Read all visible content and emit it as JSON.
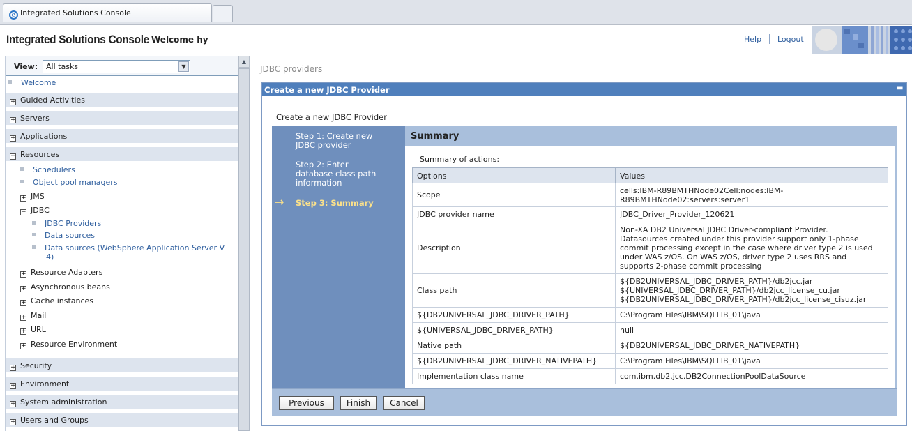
{
  "browser": {
    "tab_title": "Integrated Solutions Console"
  },
  "header": {
    "title": "Integrated Solutions Console",
    "welcome": "Welcome hy",
    "help": "Help",
    "logout": "Logout"
  },
  "nav": {
    "view_label": "View:",
    "view_value": "All tasks",
    "welcome": "Welcome",
    "guided": "Guided Activities",
    "servers": "Servers",
    "applications": "Applications",
    "resources": "Resources",
    "schedulers": "Schedulers",
    "object_pool": "Object pool managers",
    "jms": "JMS",
    "jdbc": "JDBC",
    "jdbc_providers": "JDBC Providers",
    "data_sources": "Data sources",
    "data_sources_was_1": "Data sources (WebSphere Application Server V",
    "data_sources_was_2": "4)",
    "resource_adapters": "Resource Adapters",
    "async_beans": "Asynchronous beans",
    "cache": "Cache instances",
    "mail": "Mail",
    "url": "URL",
    "resource_env": "Resource Environment",
    "security": "Security",
    "environment": "Environment",
    "sysadmin": "System administration",
    "users_groups": "Users and Groups"
  },
  "content": {
    "breadcrumb": "JDBC providers",
    "panel_title": "Create a new JDBC Provider",
    "panel_subtitle": "Create a new JDBC Provider",
    "steps": {
      "s1a": "Step 1: Create new",
      "s1b": "JDBC provider",
      "s2a": "Step 2: Enter",
      "s2b": "database class path",
      "s2c": "information",
      "s3": "Step 3: Summary"
    },
    "summary_title": "Summary",
    "summary_of_actions": "Summary of actions:",
    "table": {
      "col_options": "Options",
      "col_values": "Values",
      "rows": [
        {
          "k": "Scope",
          "v1": "cells:IBM-R89BMTHNode02Cell:nodes:IBM-",
          "v2": "R89BMTHNode02:servers:server1"
        },
        {
          "k": "JDBC provider name",
          "v1": "JDBC_Driver_Provider_120621"
        },
        {
          "k": "Description",
          "v1": "Non-XA DB2 Universal JDBC Driver-compliant Provider.",
          "v2": "Datasources created under this provider support only 1-phase",
          "v3": "commit processing except in the case where driver type 2 is used",
          "v4": "under WAS z/OS. On WAS z/OS, driver type 2 uses RRS and",
          "v5": "supports 2-phase commit processing"
        },
        {
          "k": "Class path",
          "v1": "${DB2UNIVERSAL_JDBC_DRIVER_PATH}/db2jcc.jar",
          "v2": "${UNIVERSAL_JDBC_DRIVER_PATH}/db2jcc_license_cu.jar",
          "v3": "${DB2UNIVERSAL_JDBC_DRIVER_PATH}/db2jcc_license_cisuz.jar"
        },
        {
          "k": "${DB2UNIVERSAL_JDBC_DRIVER_PATH}",
          "v1": "C:\\Program Files\\IBM\\SQLLIB_01\\java"
        },
        {
          "k": "${UNIVERSAL_JDBC_DRIVER_PATH}",
          "v1": "null"
        },
        {
          "k": "Native path",
          "v1": "${DB2UNIVERSAL_JDBC_DRIVER_NATIVEPATH}"
        },
        {
          "k": "${DB2UNIVERSAL_JDBC_DRIVER_NATIVEPATH}",
          "v1": "C:\\Program Files\\IBM\\SQLLIB_01\\java"
        },
        {
          "k": "Implementation class name",
          "v1": "com.ibm.db2.jcc.DB2ConnectionPoolDataSource"
        }
      ]
    },
    "buttons": {
      "previous": "Previous",
      "finish": "Finish",
      "cancel": "Cancel"
    }
  },
  "colors": {
    "panel_header": "#4f7fbc",
    "steps_bg": "#6f8fbd",
    "current_step": "#fbe18a",
    "link": "#2e5e9e"
  }
}
